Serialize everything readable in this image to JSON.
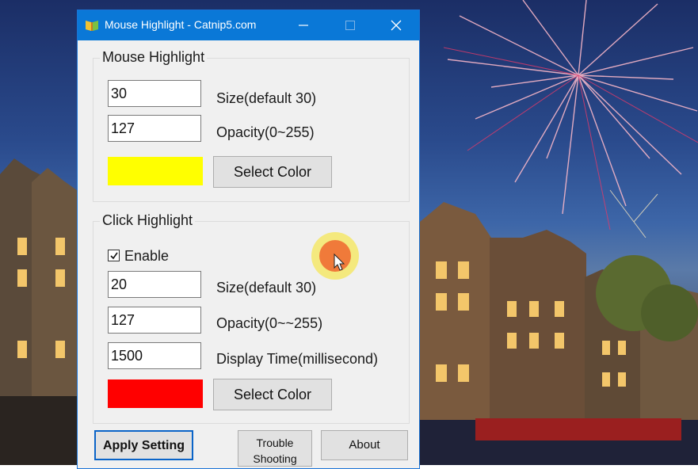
{
  "window": {
    "title": "Mouse Highlight - Catnip5.com"
  },
  "mouse_highlight": {
    "group_title": "Mouse Highlight",
    "size_value": "30",
    "size_label": "Size(default 30)",
    "opacity_value": "127",
    "opacity_label": "Opacity(0~255)",
    "color": "#ffff00",
    "select_color_label": "Select Color"
  },
  "click_highlight": {
    "group_title": "Click Highlight",
    "enable_checked": true,
    "enable_label": "Enable",
    "size_value": "20",
    "size_label": "Size(default 30)",
    "opacity_value": "127",
    "opacity_label": "Opacity(0~~255)",
    "display_time_value": "1500",
    "display_time_label": "Display Time(millisecond)",
    "color": "#ff0000",
    "select_color_label": "Select Color"
  },
  "footer": {
    "apply_label": "Apply Setting",
    "trouble_line1": "Trouble",
    "trouble_line2": "Shooting",
    "about_label": "About"
  },
  "colors": {
    "titlebar": "#0a78d7",
    "highlight_ring": "#f4e86a",
    "click_dot": "#f07a3a"
  }
}
